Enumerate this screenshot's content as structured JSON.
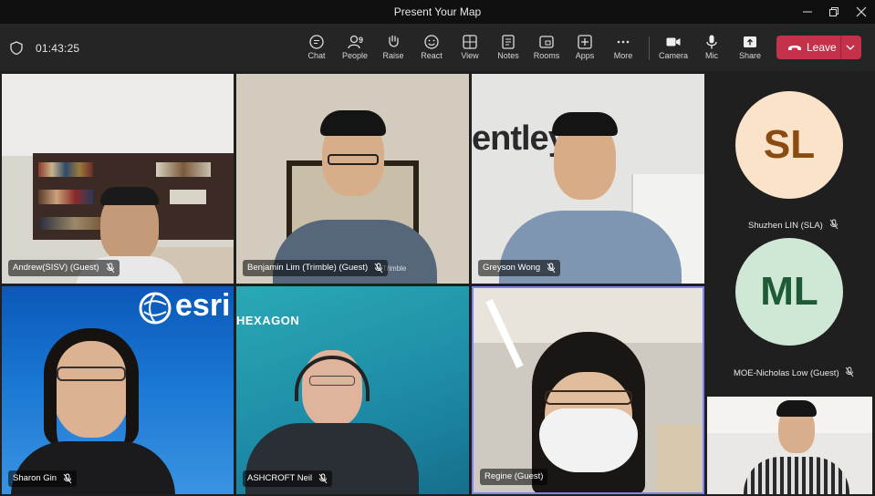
{
  "window": {
    "title": "Present Your Map"
  },
  "toolbar": {
    "timer": "01:43:25",
    "buttons": [
      {
        "label": "Chat",
        "icon": "chat-icon"
      },
      {
        "label": "People",
        "icon": "people-icon",
        "count": "9"
      },
      {
        "label": "Raise",
        "icon": "hand-icon"
      },
      {
        "label": "React",
        "icon": "smiley-icon"
      },
      {
        "label": "View",
        "icon": "grid-icon"
      },
      {
        "label": "Notes",
        "icon": "notes-icon"
      },
      {
        "label": "Rooms",
        "icon": "rooms-icon"
      },
      {
        "label": "Apps",
        "icon": "plus-icon"
      },
      {
        "label": "More",
        "icon": "ellipsis-icon"
      }
    ],
    "devices": [
      {
        "label": "Camera",
        "icon": "camera-icon"
      },
      {
        "label": "Mic",
        "icon": "mic-icon"
      },
      {
        "label": "Share",
        "icon": "share-icon"
      }
    ],
    "leave_label": "Leave",
    "leave_color": "#c4314b"
  },
  "participants": [
    {
      "name": "Andrew(SISV) (Guest)",
      "muted": true
    },
    {
      "name": "Benjamin Lim (Trimble) (Guest)",
      "muted": true,
      "background_text": "Trimble"
    },
    {
      "name": "Greyson Wong",
      "muted": true,
      "background_text": "entley"
    },
    {
      "name": "Sharon Gin",
      "muted": true,
      "background_text": "esri"
    },
    {
      "name": "ASHCROFT Neil",
      "muted": true,
      "background_text": "HEXAGON"
    },
    {
      "name": "Regine (Guest)",
      "muted": false,
      "speaking": true
    }
  ],
  "side_participants": [
    {
      "initials": "SL",
      "name": "Shuzhen LIN (SLA)",
      "bg": "#fbe3c9",
      "fg": "#8a4b10",
      "muted": true
    },
    {
      "initials": "ML",
      "name": "MOE-Nicholas Low (Guest)",
      "bg": "#cfe8d6",
      "fg": "#1e5a35",
      "muted": true
    }
  ],
  "self_view": {
    "label": "self-view"
  }
}
